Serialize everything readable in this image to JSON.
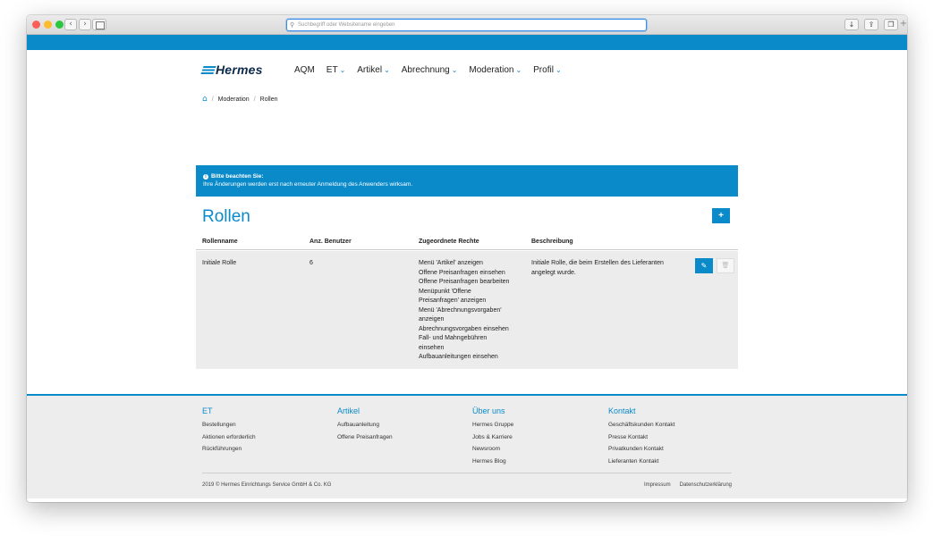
{
  "browser": {
    "url_placeholder": "Suchbegriff oder Websitename eingeben",
    "back_glyph": "‹",
    "forward_glyph": "›",
    "new_tab_glyph": "+",
    "right_buttons": [
      "↓",
      "⇪",
      "❐"
    ]
  },
  "brand": {
    "logo_text": "Hermes",
    "accent": "#0a8ac9"
  },
  "nav": {
    "items": [
      {
        "label": "AQM",
        "chevron": ""
      },
      {
        "label": "ET",
        "chevron": "⌄"
      },
      {
        "label": "Artikel",
        "chevron": "⌄"
      },
      {
        "label": "Abrechnung",
        "chevron": "⌄"
      },
      {
        "label": "Moderation",
        "chevron": "⌄"
      },
      {
        "label": "Profil",
        "chevron": "⌄"
      }
    ]
  },
  "breadcrumb": {
    "home_icon": "⌂",
    "sep": "/",
    "items": [
      "Moderation",
      "Rollen"
    ]
  },
  "alert": {
    "icon": "i",
    "title": "Bitte beachten Sie:",
    "message": "Ihre Änderungen werden erst nach erneuter Anmeldung des Anwenders wirksam."
  },
  "page": {
    "title": "Rollen",
    "add_label": "+"
  },
  "table": {
    "headers": [
      "Rollenname",
      "Anz. Benutzer",
      "Zugeordnete Rechte",
      "Beschreibung"
    ],
    "rows": [
      {
        "name": "Initiale Rolle",
        "users": "6",
        "rights": [
          "Menü 'Artikel' anzeigen",
          "Offene Preisanfragen einsehen",
          "Offene Preisanfragen bearbeiten",
          "Menüpunkt 'Offene",
          "Preisanfragen' anzeigen",
          "Menü 'Abrechnungsvorgaben'",
          "anzeigen",
          "Abrechnungsvorgaben einsehen",
          "Fall- und Mahngebühren",
          "einsehen",
          "Aufbauanleitungen einsehen"
        ],
        "description": [
          "Initiale Rolle, die beim Erstellen des Lieferanten",
          "angelegt wurde."
        ],
        "edit_icon": "✎",
        "delete_icon": "🗑"
      }
    ]
  },
  "footer": {
    "columns": [
      {
        "title": "ET",
        "links": [
          "Bestellungen",
          "Aktionen erforderlich",
          "Rückführungen"
        ]
      },
      {
        "title": "Artikel",
        "links": [
          "Aufbauanleitung",
          "Offene Preisanfragen"
        ]
      },
      {
        "title": "Über uns",
        "links": [
          "Hermes Gruppe",
          "Jobs & Karriere",
          "Newsroom",
          "Hermes Blog"
        ]
      },
      {
        "title": "Kontakt",
        "links": [
          "Geschäftskunden Kontakt",
          "Presse Kontakt",
          "Privatkunden Kontakt",
          "Lieferanten Kontakt"
        ]
      }
    ],
    "copyright": "2019 © Hermes Einrichtungs Service GmbH & Co. KG",
    "legal": [
      "Impressum",
      "Datenschutzerklärung"
    ]
  }
}
